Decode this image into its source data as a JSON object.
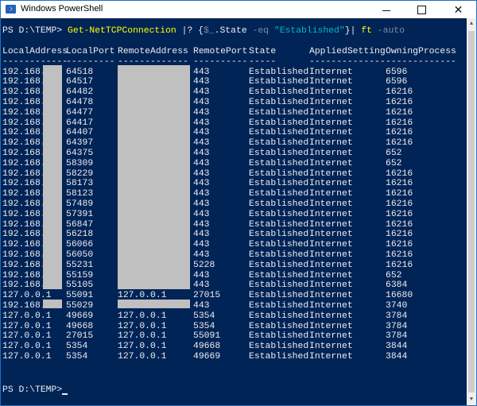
{
  "window": {
    "title": "Windows PowerShell"
  },
  "prompt": "PS D:\\TEMP>",
  "command": {
    "cmdlet": "Get-NetTCPConnection",
    "where": "|?",
    "brace_open": "{",
    "var": "$_",
    "prop": ".State",
    "op": "-eq",
    "value": "\"Established\"",
    "brace_close": "}",
    "pipe": "|",
    "ft": "ft",
    "param": "-auto"
  },
  "table": {
    "headers": [
      "LocalAddress",
      "LocalPort",
      "RemoteAddress",
      "RemotePort",
      "State",
      "AppliedSetting",
      "OwningProcess"
    ],
    "underlines": [
      "------------",
      "---------",
      "-------------",
      "----------",
      "-----",
      "--------------",
      "-------------"
    ],
    "rows": [
      [
        "192.168.",
        "64518",
        "",
        "443",
        "Established",
        "Internet",
        "6596"
      ],
      [
        "192.168.",
        "64517",
        "",
        "443",
        "Established",
        "Internet",
        "6596"
      ],
      [
        "192.168.",
        "64482",
        "",
        "443",
        "Established",
        "Internet",
        "16216"
      ],
      [
        "192.168.",
        "64478",
        "",
        "443",
        "Established",
        "Internet",
        "16216"
      ],
      [
        "192.168.",
        "64477",
        "",
        "443",
        "Established",
        "Internet",
        "16216"
      ],
      [
        "192.168.",
        "64417",
        "",
        "443",
        "Established",
        "Internet",
        "16216"
      ],
      [
        "192.168.",
        "64407",
        "",
        "443",
        "Established",
        "Internet",
        "16216"
      ],
      [
        "192.168.",
        "64397",
        "",
        "443",
        "Established",
        "Internet",
        "16216"
      ],
      [
        "192.168.",
        "64375",
        "",
        "443",
        "Established",
        "Internet",
        "652"
      ],
      [
        "192.168.",
        "58309",
        "",
        "443",
        "Established",
        "Internet",
        "652"
      ],
      [
        "192.168.",
        "58229",
        "",
        "443",
        "Established",
        "Internet",
        "16216"
      ],
      [
        "192.168.",
        "58173",
        "",
        "443",
        "Established",
        "Internet",
        "16216"
      ],
      [
        "192.168.",
        "58123",
        "",
        "443",
        "Established",
        "Internet",
        "16216"
      ],
      [
        "192.168.",
        "57489",
        "",
        "443",
        "Established",
        "Internet",
        "16216"
      ],
      [
        "192.168.",
        "57391",
        "",
        "443",
        "Established",
        "Internet",
        "16216"
      ],
      [
        "192.168.",
        "56847",
        "",
        "443",
        "Established",
        "Internet",
        "16216"
      ],
      [
        "192.168.",
        "56218",
        "",
        "443",
        "Established",
        "Internet",
        "16216"
      ],
      [
        "192.168.",
        "56066",
        "",
        "443",
        "Established",
        "Internet",
        "16216"
      ],
      [
        "192.168.",
        "56050",
        "",
        "443",
        "Established",
        "Internet",
        "16216"
      ],
      [
        "192.168.",
        "55231",
        "",
        "5228",
        "Established",
        "Internet",
        "16216"
      ],
      [
        "192.168.",
        "55159",
        "",
        "443",
        "Established",
        "Internet",
        "652"
      ],
      [
        "192.168.",
        "55105",
        "",
        "443",
        "Established",
        "Internet",
        "6384"
      ],
      [
        "127.0.0.1",
        "55091",
        "127.0.0.1",
        "27015",
        "Established",
        "Internet",
        "16680"
      ],
      [
        "192.168.",
        "55029",
        "",
        "443",
        "Established",
        "Internet",
        "3740"
      ],
      [
        "127.0.0.1",
        "49669",
        "127.0.0.1",
        "5354",
        "Established",
        "Internet",
        "3784"
      ],
      [
        "127.0.0.1",
        "49668",
        "127.0.0.1",
        "5354",
        "Established",
        "Internet",
        "3784"
      ],
      [
        "127.0.0.1",
        "27015",
        "127.0.0.1",
        "55091",
        "Established",
        "Internet",
        "3784"
      ],
      [
        "127.0.0.1",
        "5354",
        "127.0.0.1",
        "49668",
        "Established",
        "Internet",
        "3844"
      ],
      [
        "127.0.0.1",
        "5354",
        "127.0.0.1",
        "49669",
        "Established",
        "Internet",
        "3844"
      ]
    ]
  },
  "final_prompt": "PS D:\\TEMP>",
  "colors": {
    "background": "#012456",
    "text": "#eeedf0",
    "command": "#ffff00",
    "string": "#00b7c3",
    "operator": "#7f8ba0",
    "redaction": "#c0c0c0"
  }
}
